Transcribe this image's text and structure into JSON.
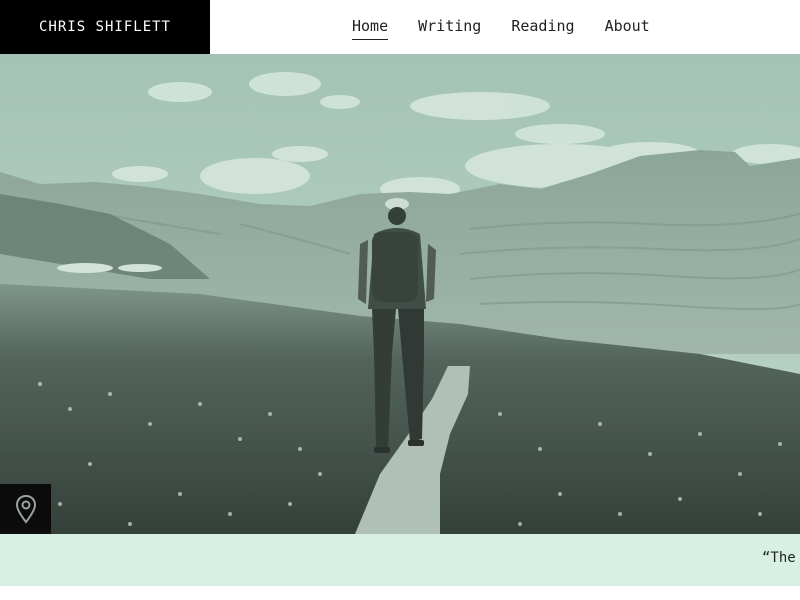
{
  "site": {
    "title": "CHRIS SHIFLETT"
  },
  "nav": {
    "items": [
      {
        "label": "Home",
        "active": true
      },
      {
        "label": "Writing",
        "active": false
      },
      {
        "label": "Reading",
        "active": false
      },
      {
        "label": "About",
        "active": false
      }
    ]
  },
  "hero": {
    "location_icon": "map-pin-icon"
  },
  "quote": {
    "text": "“The"
  },
  "colors": {
    "header_bg": "#000000",
    "quote_band": "#d8f0e3",
    "tint": "#7fa596"
  }
}
